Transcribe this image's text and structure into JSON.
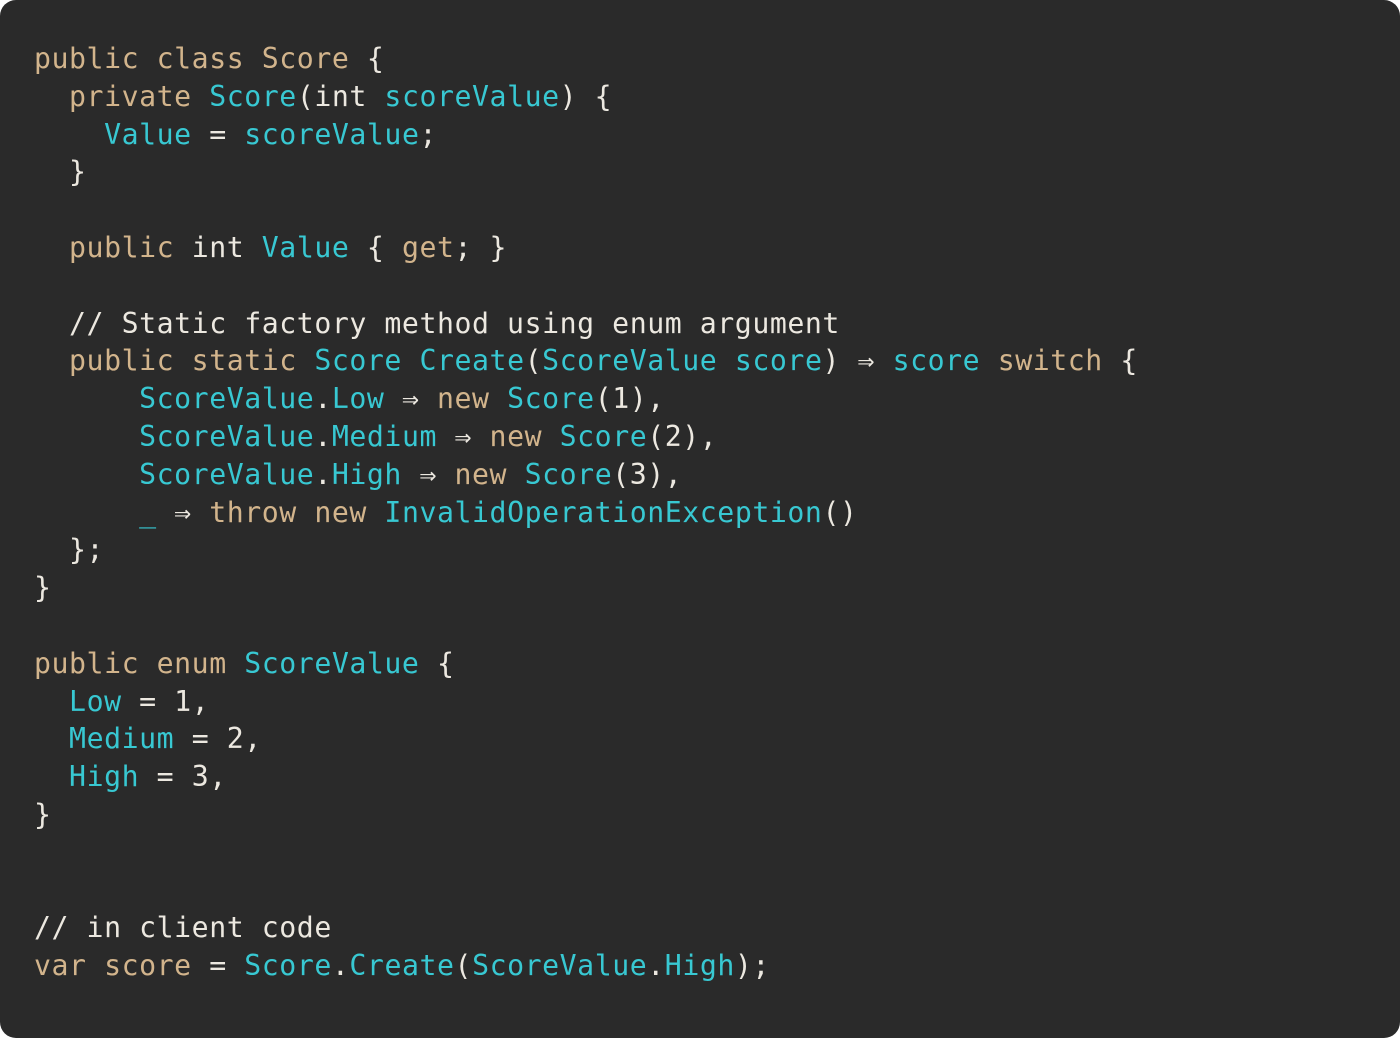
{
  "theme": {
    "background": "#2a2a2a",
    "colors": {
      "keyword": "#d2b48c",
      "type": "#38c8d2",
      "plain": "#ece8e0",
      "comment": "#ece8e0"
    }
  },
  "lines": [
    [
      {
        "t": "public class ",
        "c": "keyword"
      },
      {
        "t": "Score",
        "c": "keyword"
      },
      {
        "t": " {",
        "c": "plain"
      }
    ],
    [
      {
        "t": "  private ",
        "c": "keyword"
      },
      {
        "t": "Score",
        "c": "type"
      },
      {
        "t": "(int ",
        "c": "plain"
      },
      {
        "t": "scoreValue",
        "c": "type"
      },
      {
        "t": ") {",
        "c": "plain"
      }
    ],
    [
      {
        "t": "    ",
        "c": "plain"
      },
      {
        "t": "Value",
        "c": "type"
      },
      {
        "t": " = ",
        "c": "plain"
      },
      {
        "t": "scoreValue",
        "c": "type"
      },
      {
        "t": ";",
        "c": "plain"
      }
    ],
    [
      {
        "t": "  }",
        "c": "plain"
      }
    ],
    [],
    [
      {
        "t": "  public ",
        "c": "keyword"
      },
      {
        "t": "int ",
        "c": "plain"
      },
      {
        "t": "Value",
        "c": "type"
      },
      {
        "t": " { ",
        "c": "plain"
      },
      {
        "t": "get",
        "c": "keyword"
      },
      {
        "t": "; }",
        "c": "plain"
      }
    ],
    [],
    [
      {
        "t": "  // Static factory method using enum argument",
        "c": "comment"
      }
    ],
    [
      {
        "t": "  public static ",
        "c": "keyword"
      },
      {
        "t": "Score",
        "c": "type"
      },
      {
        "t": " ",
        "c": "plain"
      },
      {
        "t": "Create",
        "c": "type"
      },
      {
        "t": "(",
        "c": "plain"
      },
      {
        "t": "ScoreValue",
        "c": "type"
      },
      {
        "t": " ",
        "c": "plain"
      },
      {
        "t": "score",
        "c": "type"
      },
      {
        "t": ") ⇒ ",
        "c": "plain"
      },
      {
        "t": "score",
        "c": "type"
      },
      {
        "t": " ",
        "c": "plain"
      },
      {
        "t": "switch",
        "c": "keyword"
      },
      {
        "t": " {",
        "c": "plain"
      }
    ],
    [
      {
        "t": "      ",
        "c": "plain"
      },
      {
        "t": "ScoreValue",
        "c": "type"
      },
      {
        "t": ".",
        "c": "plain"
      },
      {
        "t": "Low",
        "c": "type"
      },
      {
        "t": " ⇒ ",
        "c": "plain"
      },
      {
        "t": "new ",
        "c": "keyword"
      },
      {
        "t": "Score",
        "c": "type"
      },
      {
        "t": "(1),",
        "c": "plain"
      }
    ],
    [
      {
        "t": "      ",
        "c": "plain"
      },
      {
        "t": "ScoreValue",
        "c": "type"
      },
      {
        "t": ".",
        "c": "plain"
      },
      {
        "t": "Medium",
        "c": "type"
      },
      {
        "t": " ⇒ ",
        "c": "plain"
      },
      {
        "t": "new ",
        "c": "keyword"
      },
      {
        "t": "Score",
        "c": "type"
      },
      {
        "t": "(2),",
        "c": "plain"
      }
    ],
    [
      {
        "t": "      ",
        "c": "plain"
      },
      {
        "t": "ScoreValue",
        "c": "type"
      },
      {
        "t": ".",
        "c": "plain"
      },
      {
        "t": "High",
        "c": "type"
      },
      {
        "t": " ⇒ ",
        "c": "plain"
      },
      {
        "t": "new ",
        "c": "keyword"
      },
      {
        "t": "Score",
        "c": "type"
      },
      {
        "t": "(3),",
        "c": "plain"
      }
    ],
    [
      {
        "t": "      ",
        "c": "plain"
      },
      {
        "t": "_",
        "c": "type"
      },
      {
        "t": " ⇒ ",
        "c": "plain"
      },
      {
        "t": "throw new ",
        "c": "keyword"
      },
      {
        "t": "InvalidOperationException",
        "c": "type"
      },
      {
        "t": "()",
        "c": "plain"
      }
    ],
    [
      {
        "t": "  };",
        "c": "plain"
      }
    ],
    [
      {
        "t": "}",
        "c": "plain"
      }
    ],
    [],
    [
      {
        "t": "public enum ",
        "c": "keyword"
      },
      {
        "t": "ScoreValue",
        "c": "type"
      },
      {
        "t": " {",
        "c": "plain"
      }
    ],
    [
      {
        "t": "  ",
        "c": "plain"
      },
      {
        "t": "Low",
        "c": "type"
      },
      {
        "t": " = 1,",
        "c": "plain"
      }
    ],
    [
      {
        "t": "  ",
        "c": "plain"
      },
      {
        "t": "Medium",
        "c": "type"
      },
      {
        "t": " = 2,",
        "c": "plain"
      }
    ],
    [
      {
        "t": "  ",
        "c": "plain"
      },
      {
        "t": "High",
        "c": "type"
      },
      {
        "t": " = 3,",
        "c": "plain"
      }
    ],
    [
      {
        "t": "}",
        "c": "plain"
      }
    ],
    [],
    [],
    [
      {
        "t": "// in client code",
        "c": "comment"
      }
    ],
    [
      {
        "t": "var ",
        "c": "keyword"
      },
      {
        "t": "score",
        "c": "keyword"
      },
      {
        "t": " = ",
        "c": "plain"
      },
      {
        "t": "Score",
        "c": "type"
      },
      {
        "t": ".",
        "c": "plain"
      },
      {
        "t": "Create",
        "c": "type"
      },
      {
        "t": "(",
        "c": "plain"
      },
      {
        "t": "ScoreValue",
        "c": "type"
      },
      {
        "t": ".",
        "c": "plain"
      },
      {
        "t": "High",
        "c": "type"
      },
      {
        "t": ");",
        "c": "plain"
      }
    ]
  ]
}
